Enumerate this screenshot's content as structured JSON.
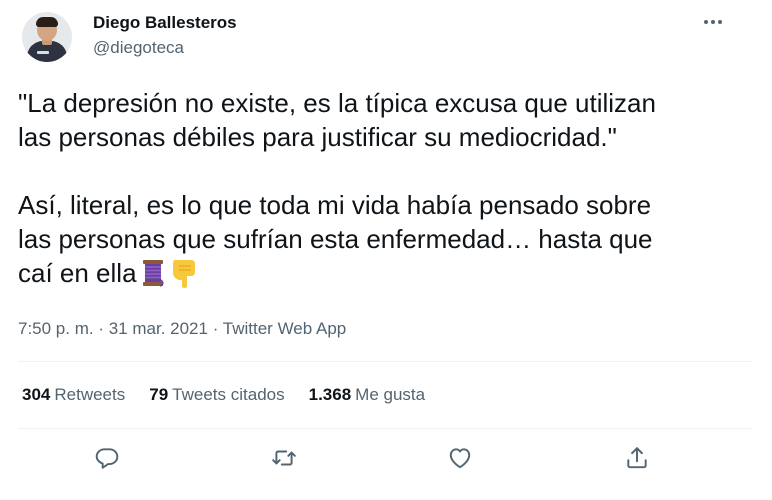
{
  "author": {
    "name": "Diego Ballesteros",
    "handle": "@diegoteca"
  },
  "icons": {
    "more": "more-options-icon",
    "reply": "reply-icon",
    "retweet": "retweet-icon",
    "like": "like-icon",
    "share": "share-icon",
    "thread_emoji": "spool-of-thread-emoji",
    "pointing_emoji": "backhand-index-pointing-down-emoji"
  },
  "tweet": {
    "lines": [
      "\"La depresión no existe, es la típica excusa que utilizan",
      "las personas débiles para justificar su mediocridad.\"",
      "Así, literal, es lo que toda mi vida había pensado sobre",
      "las personas que sufrían esta enfermedad… hasta que",
      "caí en ella"
    ]
  },
  "meta": {
    "time": "7:50 p. m.",
    "separator": " · ",
    "date": "31 mar. 2021",
    "source": "Twitter Web App"
  },
  "stats": {
    "retweets_count": "304",
    "retweets_label": "Retweets",
    "quotes_count": "79",
    "quotes_label": "Tweets citados",
    "likes_count": "1.368",
    "likes_label": "Me gusta"
  },
  "colors": {
    "text_primary": "#0f1419",
    "text_secondary": "#536471",
    "divider": "#eff3f4"
  }
}
